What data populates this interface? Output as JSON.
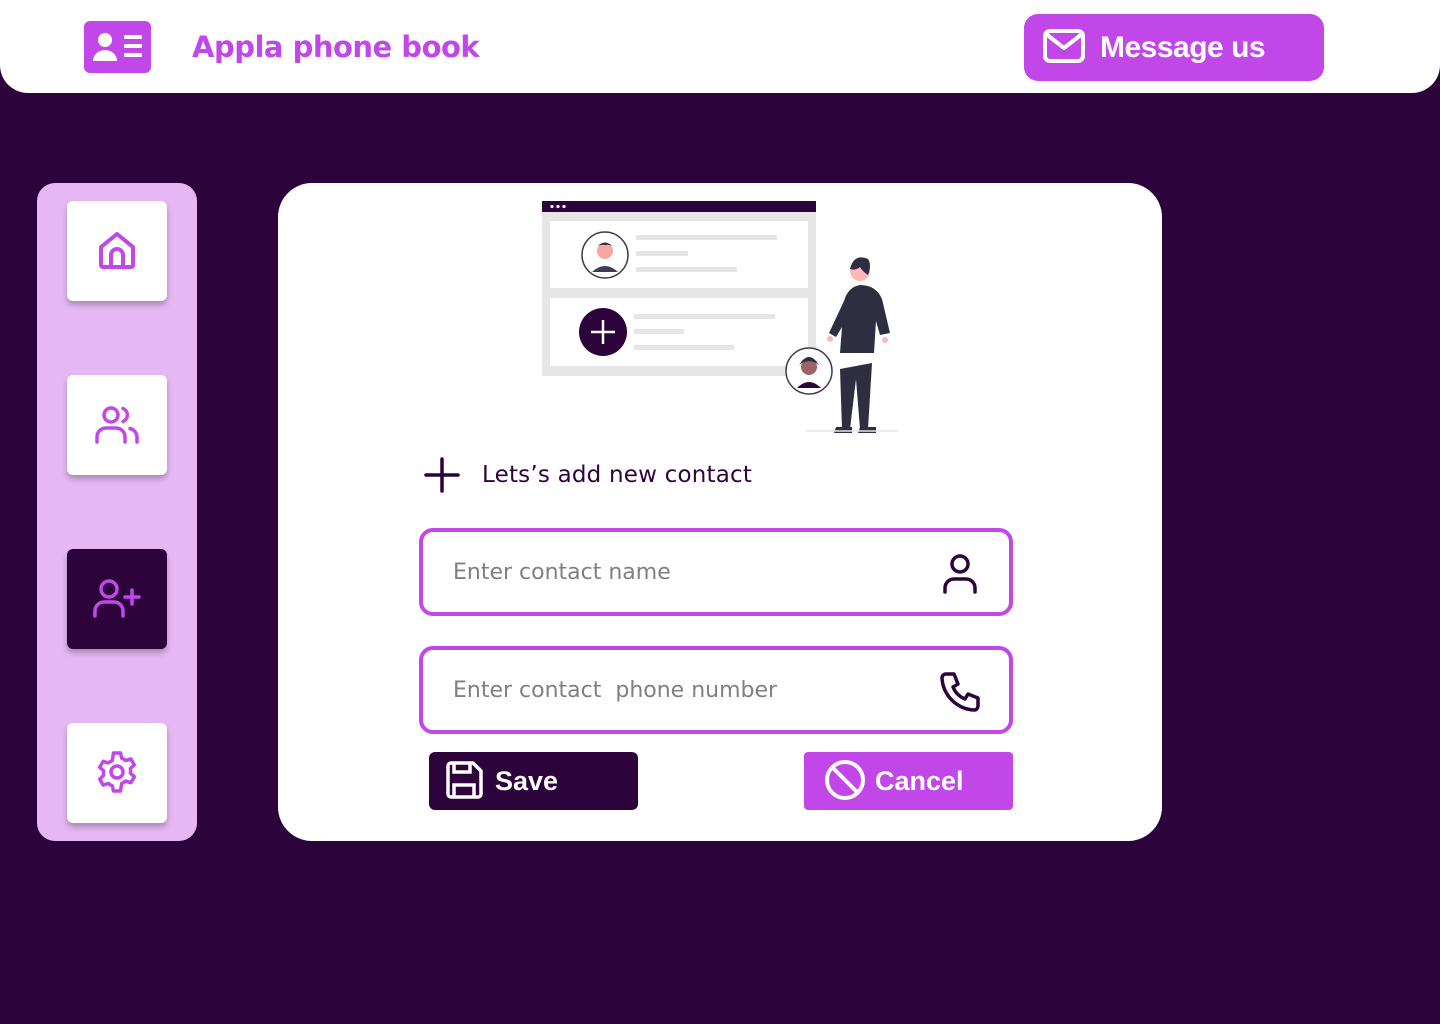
{
  "header": {
    "logo_icon": "contact-card-icon",
    "title": "Appla phone book",
    "message_button": {
      "label": "Message us",
      "icon": "mail-icon"
    }
  },
  "sidebar": {
    "items": [
      {
        "id": "home",
        "icon": "home-icon",
        "active": false
      },
      {
        "id": "contacts",
        "icon": "users-icon",
        "active": false
      },
      {
        "id": "add-contact",
        "icon": "user-plus-icon",
        "active": true
      },
      {
        "id": "settings",
        "icon": "gear-icon",
        "active": false
      }
    ]
  },
  "form": {
    "heading": "Lets’s add new contact",
    "name_field": {
      "placeholder": "Enter contact name",
      "value": "",
      "icon": "user-icon"
    },
    "phone_field": {
      "placeholder": "Enter contact  phone number",
      "value": "",
      "icon": "phone-icon"
    },
    "save_button": {
      "label": "Save",
      "icon": "floppy-disk-icon"
    },
    "cancel_button": {
      "label": "Cancel",
      "icon": "ban-icon"
    }
  },
  "colors": {
    "background": "#2d033b",
    "accent": "#c147e9",
    "sidebar_bg": "#e5b8f4",
    "surface": "#ffffff"
  }
}
